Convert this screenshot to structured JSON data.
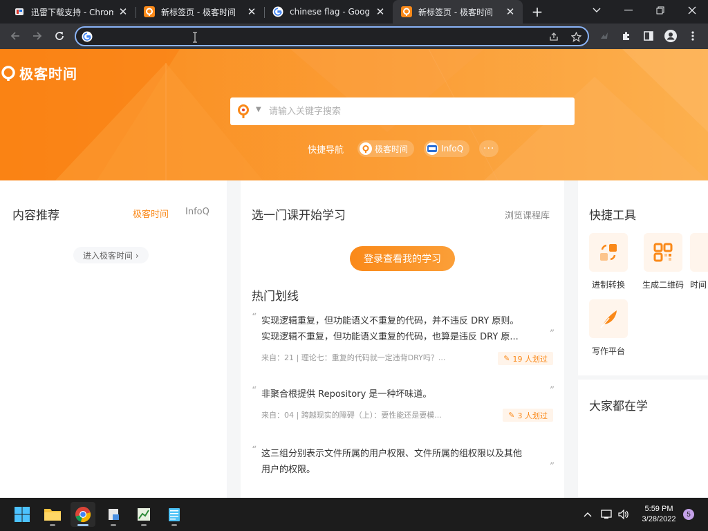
{
  "browser": {
    "tabs": [
      {
        "title": "迅雷下载支持 - Chrome",
        "favicon": "xunlei-icon",
        "active": false
      },
      {
        "title": "新标签页 - 极客时间",
        "favicon": "geektime-icon",
        "active": false
      },
      {
        "title": "chinese flag - Google S",
        "favicon": "google-icon",
        "active": false
      },
      {
        "title": "新标签页 - 极客时间",
        "favicon": "geektime-icon",
        "active": true
      }
    ],
    "address_value": ""
  },
  "hero": {
    "logo_text": "极客时间",
    "search_placeholder": "请输入关键字搜索",
    "quicknav_label": "快捷导航",
    "quicknav_items": [
      "极客时间",
      "InfoQ"
    ],
    "more_label": "···"
  },
  "recommend": {
    "title": "内容推荐",
    "tabs": [
      "极客时间",
      "InfoQ"
    ],
    "active_tab": "极客时间",
    "enter_button": "进入极客时间 ›"
  },
  "learning": {
    "title": "选一门课开始学习",
    "browse_link": "浏览课程库",
    "login_button": "登录查看我的学习",
    "hot_title": "热门划线",
    "highlights": [
      {
        "lines": [
          "实现逻辑重复，但功能语义不重复的代码，并不违反 DRY 原则。",
          "实现逻辑不重复，但功能语义重复的代码，也算是违反 DRY 原..."
        ],
        "meta": "来自：21 | 理论七：重复的代码就一定违背DRY吗？...",
        "count": "19 人划过"
      },
      {
        "lines": [
          "非聚合根提供 Repository 是一种坏味道。"
        ],
        "meta": "来自：04 | 跨越现实的障碍（上）：要性能还是要模...",
        "count": "3 人划过"
      },
      {
        "lines": [
          "这三组分别表示文件所属的用户权限、文件所属的组权限以及其他",
          "用户的权限。"
        ],
        "meta": "",
        "count": ""
      }
    ]
  },
  "tools": {
    "title": "快捷工具",
    "items": [
      {
        "label": "进制转换",
        "icon": "convert-icon"
      },
      {
        "label": "生成二维码",
        "icon": "qrcode-icon"
      },
      {
        "label": "时间",
        "icon": "time-icon"
      },
      {
        "label": "写作平台",
        "icon": "feather-icon"
      }
    ]
  },
  "studying": {
    "title": "大家都在学"
  },
  "taskbar": {
    "time": "5:59 PM",
    "date": "3/28/2022",
    "notification_count": "5"
  },
  "colors": {
    "brand_orange": "#fa8919",
    "omnibox_focus": "#8ab4f8",
    "tab_strip": "#202124",
    "toolbar": "#35363a"
  }
}
